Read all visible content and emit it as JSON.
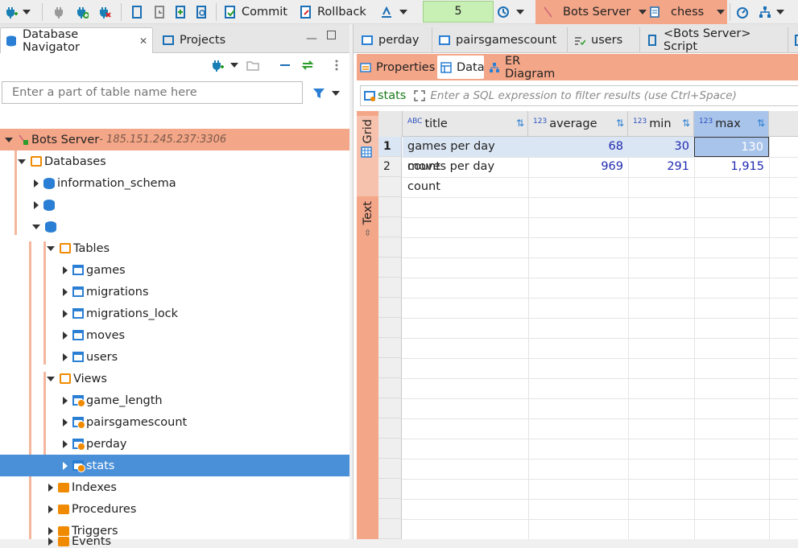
{
  "toolbar": {
    "commit_label": "Commit",
    "rollback_label": "Rollback",
    "tx_count": "5",
    "connection": "Bots Server",
    "database": "chess"
  },
  "left": {
    "tabs": [
      {
        "label": "Database Navigator"
      },
      {
        "label": "Projects"
      }
    ],
    "filter_placeholder": "Enter a part of table name here",
    "tree": [
      {
        "label": "Bots Server",
        "suffix": " - 185.151.245.237:3306",
        "level": 0,
        "expanded": true,
        "kind": "server"
      },
      {
        "label": "Databases",
        "level": 1,
        "expanded": true,
        "kind": "folder-tbl"
      },
      {
        "label": "information_schema",
        "level": 2,
        "expanded": false,
        "kind": "db"
      },
      {
        "label": "",
        "level": 2,
        "expanded": false,
        "kind": "db"
      },
      {
        "label": "",
        "level": 2,
        "expanded": true,
        "kind": "db"
      },
      {
        "label": "Tables",
        "level": 3,
        "expanded": true,
        "kind": "folder-tbl"
      },
      {
        "label": "games",
        "level": 4,
        "expanded": false,
        "kind": "table"
      },
      {
        "label": "migrations",
        "level": 4,
        "expanded": false,
        "kind": "table"
      },
      {
        "label": "migrations_lock",
        "level": 4,
        "expanded": false,
        "kind": "table"
      },
      {
        "label": "moves",
        "level": 4,
        "expanded": false,
        "kind": "table"
      },
      {
        "label": "users",
        "level": 4,
        "expanded": false,
        "kind": "table"
      },
      {
        "label": "Views",
        "level": 3,
        "expanded": true,
        "kind": "views"
      },
      {
        "label": "game_length",
        "level": 4,
        "expanded": false,
        "kind": "view"
      },
      {
        "label": "pairsgamescount",
        "level": 4,
        "expanded": false,
        "kind": "view"
      },
      {
        "label": "perday",
        "level": 4,
        "expanded": false,
        "kind": "view"
      },
      {
        "label": "stats",
        "level": 4,
        "expanded": false,
        "kind": "view",
        "selected": true
      },
      {
        "label": "Indexes",
        "level": 3,
        "expanded": false,
        "kind": "folder"
      },
      {
        "label": "Procedures",
        "level": 3,
        "expanded": false,
        "kind": "folder"
      },
      {
        "label": "Triggers",
        "level": 3,
        "expanded": false,
        "kind": "folder"
      },
      {
        "label": "Events",
        "level": 3,
        "expanded": false,
        "kind": "folder"
      }
    ]
  },
  "editor": {
    "tabs": [
      {
        "label": "perday"
      },
      {
        "label": "pairsgamescount"
      },
      {
        "label": "users"
      },
      {
        "label": "<Bots Server> Script"
      }
    ],
    "subtabs": [
      {
        "label": "Properties"
      },
      {
        "label": "Data"
      },
      {
        "label": "ER Diagram"
      }
    ],
    "filter_entity": "stats",
    "filter_placeholder": "Enter a SQL expression to filter results (use Ctrl+Space)",
    "side_tabs": {
      "grid": "Grid",
      "text": "Text"
    }
  },
  "grid": {
    "columns": [
      {
        "type": "ABC",
        "name": "title"
      },
      {
        "type": "123",
        "name": "average"
      },
      {
        "type": "123",
        "name": "min"
      },
      {
        "type": "123",
        "name": "max"
      }
    ],
    "rows": [
      {
        "num": "1",
        "cells": [
          "games per day count",
          "68",
          "30",
          "130"
        ]
      },
      {
        "num": "2",
        "cells": [
          "moves per day count",
          "969",
          "291",
          "1,915"
        ]
      }
    ]
  },
  "colors": {
    "accent": "#f4a688",
    "selection": "#4a90d9",
    "cell_selected": "#a9c4ea",
    "row_highlight": "#dbe6f4"
  }
}
